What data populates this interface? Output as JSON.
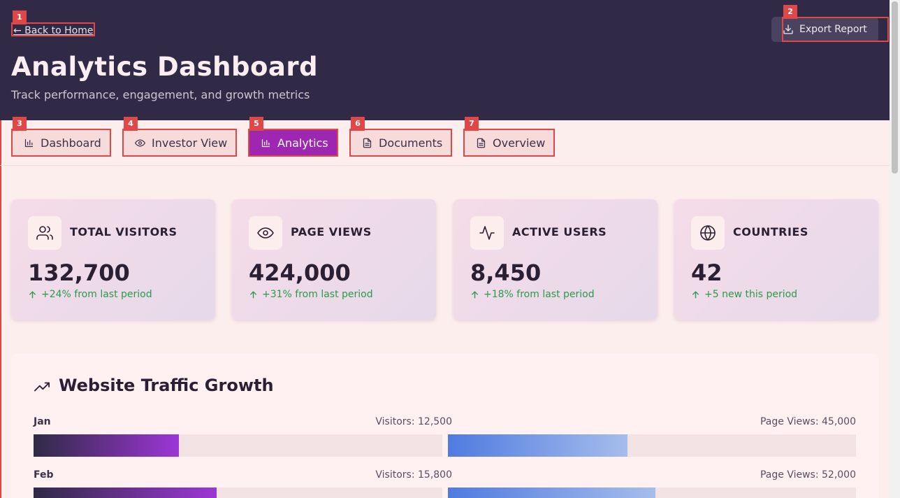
{
  "header": {
    "back_label": "← Back to Home",
    "export_label": "Export Report",
    "title": "Analytics Dashboard",
    "subtitle": "Track performance, engagement, and growth metrics"
  },
  "tabs": [
    {
      "label": "Dashboard",
      "icon": "bar-chart-icon",
      "active": false
    },
    {
      "label": "Investor View",
      "icon": "eye-icon",
      "active": false
    },
    {
      "label": "Analytics",
      "icon": "bar-chart-icon",
      "active": true
    },
    {
      "label": "Documents",
      "icon": "document-icon",
      "active": false
    },
    {
      "label": "Overview",
      "icon": "document-icon",
      "active": false
    }
  ],
  "badges": [
    "1",
    "2",
    "3",
    "4",
    "5",
    "6",
    "7"
  ],
  "stats": [
    {
      "label": "TOTAL VISITORS",
      "value": "132,700",
      "change": "+24% from last period",
      "icon": "users-icon"
    },
    {
      "label": "PAGE VIEWS",
      "value": "424,000",
      "change": "+31% from last period",
      "icon": "eye-icon"
    },
    {
      "label": "ACTIVE USERS",
      "value": "8,450",
      "change": "+18% from last period",
      "icon": "activity-icon"
    },
    {
      "label": "COUNTRIES",
      "value": "42",
      "change": "+5 new this period",
      "icon": "globe-icon"
    }
  ],
  "traffic": {
    "title": "Website Traffic Growth",
    "icon": "trending-up-icon",
    "rows": [
      {
        "month": "Jan",
        "visitors_label": "Visitors: 12,500",
        "views_label": "Page Views: 45,000",
        "visitors_fill": 0.355,
        "views_fill": 0.44
      },
      {
        "month": "Feb",
        "visitors_label": "Visitors: 15,800",
        "views_label": "Page Views: 52,000",
        "visitors_fill": 0.448,
        "views_fill": 0.508
      }
    ]
  },
  "colors": {
    "header_bg": "#312a47",
    "accent": "#9d27b0",
    "positive": "#2a9a4a",
    "annotation": "#e04848"
  }
}
